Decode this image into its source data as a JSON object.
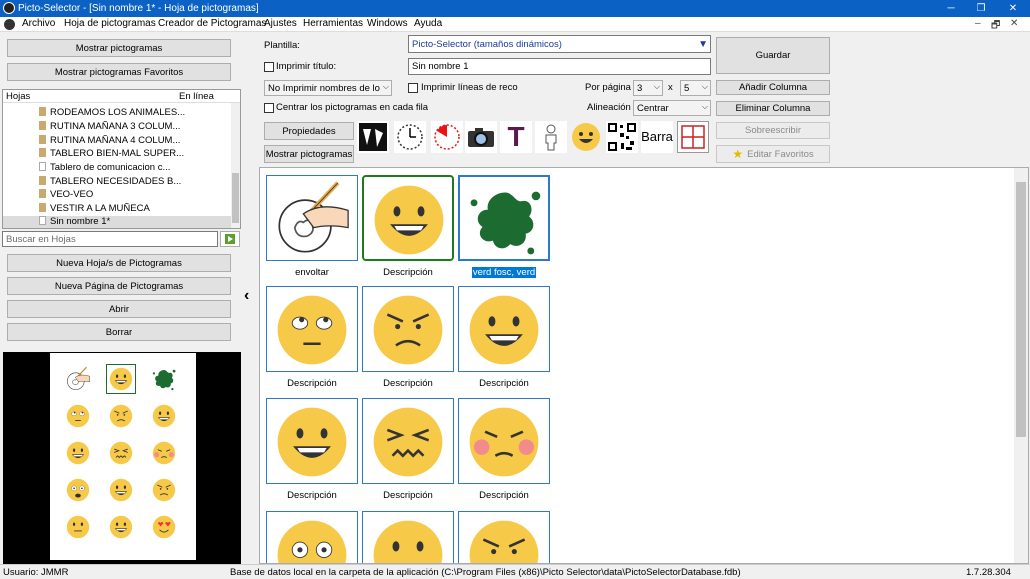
{
  "window": {
    "title": "Picto-Selector - [Sin nombre 1* - Hoja de pictogramas]",
    "min": "─",
    "max": "❐",
    "close": "✕"
  },
  "menu": [
    "Archivo",
    "Hoja de pictogramas",
    "Creador de Pictogramas",
    "Ajustes",
    "Herramientas",
    "Windows",
    "Ayuda"
  ],
  "mdi": {
    "min": "–",
    "restore": "🗗",
    "close": "✕"
  },
  "left": {
    "show_pictos": "Mostrar pictogramas",
    "show_favs": "Mostrar pictogramas Favoritos",
    "tree_header": "Hojas",
    "tree_header2": "En línea",
    "tree_items": [
      "RODEAMOS LOS ANIMALES...",
      "RUTINA MAÑANA 3 COLUM...",
      "RUTINA MAÑANA 4 COLUM...",
      "TABLERO BIEN-MAL SUPER...",
      "Tablero de comunicacion c...",
      "TABLERO NECESIDADES B...",
      "VEO-VEO",
      "VESTIR A LA MUÑECA",
      "Sin nombre 1*"
    ],
    "search_placeholder": "Buscar en Hojas",
    "new_sheet": "Nueva Hoja/s de Pictogramas",
    "new_page": "Nueva Página de Pictogramas",
    "open": "Abrir",
    "delete": "Borrar",
    "collapse_arrow": "‹"
  },
  "settings": {
    "template_label": "Plantilla:",
    "template_value": "Picto-Selector (tamaños dinámicos)",
    "print_title_label": "Imprimir título:",
    "title_value": "Sin nombre 1",
    "names_select": "No Imprimir nombres de lo",
    "print_lines_label": "Imprimir líneas de reco",
    "per_page_label": "Por página",
    "per_page_cols": "3",
    "times": "x",
    "per_page_rows": "5",
    "center_label": "Centrar los pictogramas en cada fila",
    "align_label": "Alineación",
    "align_value": "Centrar",
    "properties": "Propiedades",
    "show_pictos": "Mostrar pictogramas",
    "bar_label": "Barra",
    "t_letter": "T"
  },
  "actions": {
    "save": "Guardar",
    "add_col": "Añadir Columna",
    "del_col": "Eliminar Columna",
    "overwrite": "Sobreescribir",
    "edit_favs": "Editar Favoritos"
  },
  "cells": [
    {
      "label": "envoltar",
      "kind": "draw"
    },
    {
      "label": "Descripción",
      "kind": "smile"
    },
    {
      "label": "verd fosc, verd",
      "kind": "splash"
    },
    {
      "label": "Descripción",
      "kind": "rolleyes"
    },
    {
      "label": "Descripción",
      "kind": "angry"
    },
    {
      "label": "Descripción",
      "kind": "smile"
    },
    {
      "label": "Descripción",
      "kind": "smile"
    },
    {
      "label": "Descripción",
      "kind": "squint"
    },
    {
      "label": "Descripción",
      "kind": "blush"
    },
    {
      "label": "",
      "kind": "scared"
    },
    {
      "label": "",
      "kind": "neutral"
    },
    {
      "label": "",
      "kind": "angry"
    }
  ],
  "status": {
    "user": "Usuario: JMMR",
    "db": "Base de datos local en la carpeta de la aplicación (C:\\Program Files (x86)\\Picto Selector\\data\\PictoSelectorDatabase.fdb)",
    "version": "1.7.28.304"
  },
  "colors": {
    "titlebar": "#0b62c4",
    "emoji": "#f7c948",
    "green": "#1c6b30",
    "selection": "#0078d7"
  }
}
